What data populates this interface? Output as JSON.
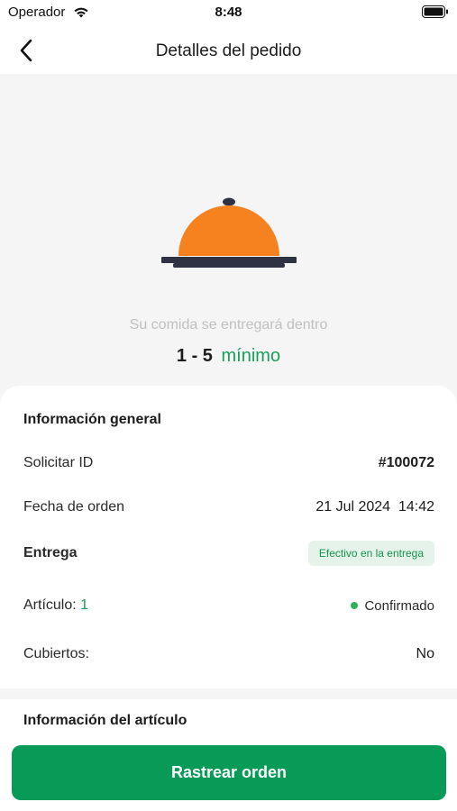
{
  "status_bar": {
    "carrier": "Operador",
    "time": "8:48"
  },
  "nav": {
    "title": "Detalles del pedido"
  },
  "hero": {
    "caption": "Su comida se entregará dentro",
    "eta_range": "1 - 5",
    "eta_unit": "mínimo",
    "cloche_color": "#f5821f"
  },
  "general_info": {
    "title": "Información general",
    "order_id_label": "Solicitar ID",
    "order_id_value": "#100072",
    "order_date_label": "Fecha de orden",
    "order_date_value": "21 Jul 2024  14:42",
    "delivery_label": "Entrega",
    "delivery_badge": "Efectivo en la entrega",
    "items_label": "Artículo:",
    "items_count": "1",
    "status_text": "Confirmado",
    "cutlery_label": "Cubiertos:",
    "cutlery_value": "No"
  },
  "item_info": {
    "title": "Información del artículo"
  },
  "actions": {
    "track_order_label": "Rastrear orden"
  },
  "colors": {
    "accent_green": "#079b57",
    "status_green": "#2eb15d"
  },
  "icons": [
    "wifi-icon",
    "battery-icon",
    "back-arrow-icon",
    "food-cloche-icon"
  ]
}
